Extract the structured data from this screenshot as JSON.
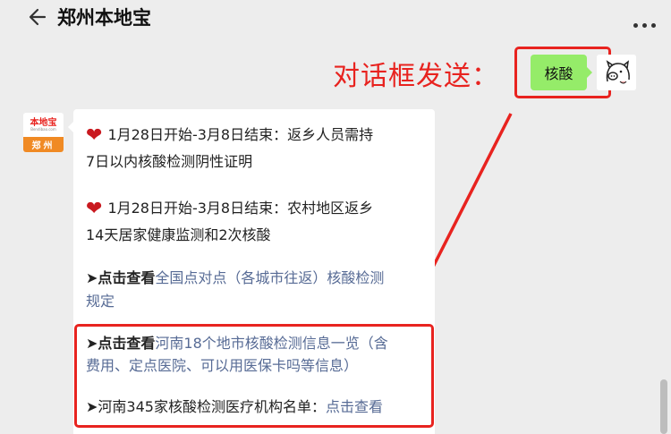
{
  "header": {
    "title": "郑州本地宝",
    "back_icon": "arrow-left-icon",
    "more_icon": "more-dots-icon"
  },
  "annotation": {
    "text": "对话框发送：",
    "color": "#e8231f"
  },
  "sent_message": {
    "text": "核酸",
    "bubble_color": "#95ec69"
  },
  "bot": {
    "avatar_top": "本地宝",
    "avatar_url": "Bendibao.com",
    "avatar_bottom": "郑州"
  },
  "reply": {
    "item1_part1": "1月28日开始-3月8日结束：返乡人员需持",
    "item1_part2": "7日以内核酸检测阴性证明",
    "item2_part1": "1月28日开始-3月8日结束：农村地区返乡",
    "item2_part2": "14天居家健康监测和2次核酸",
    "item3_prefix": "➤点击查看",
    "item3_link_part1": "全国点对点（各城市往返）核酸检测",
    "item3_link_part2": "规定",
    "item4_prefix": "➤点击查看",
    "item4_link_part1": "河南18个地市核酸检测信息一览（含",
    "item4_link_part2": "费用、定点医院、可以用医保卡吗等信息）",
    "item5_text": "➤河南345家核酸检测医疗机构名单：",
    "item5_link": "点击查看"
  },
  "colors": {
    "link": "#576b95",
    "highlight": "#e8231f",
    "heart": "#c9191f"
  }
}
